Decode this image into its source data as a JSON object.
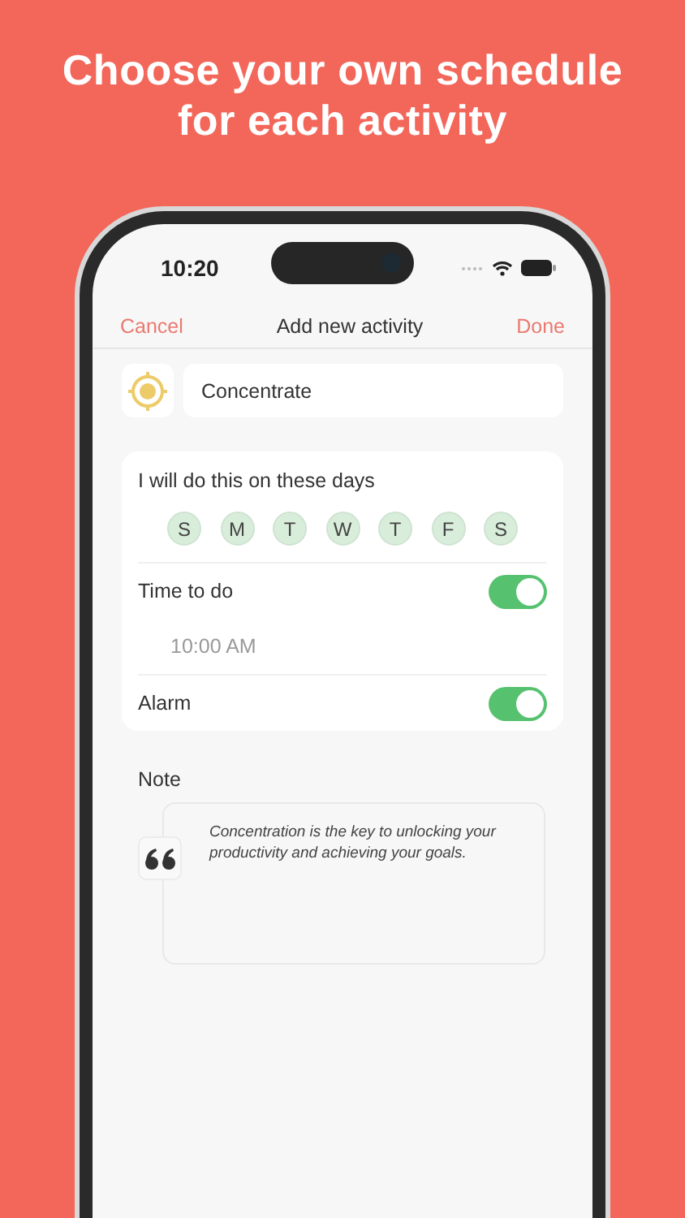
{
  "headline": "Choose your own schedule for each activity",
  "status_bar": {
    "time": "10:20"
  },
  "nav": {
    "cancel": "Cancel",
    "title": "Add new activity",
    "done": "Done"
  },
  "activity": {
    "name": "Concentrate"
  },
  "days": {
    "label": "I will do this on these days",
    "items": [
      {
        "label": "S",
        "selected": true
      },
      {
        "label": "M",
        "selected": true
      },
      {
        "label": "T",
        "selected": true
      },
      {
        "label": "W",
        "selected": true
      },
      {
        "label": "T",
        "selected": true
      },
      {
        "label": "F",
        "selected": true
      },
      {
        "label": "S",
        "selected": true
      }
    ]
  },
  "time_to_do": {
    "label": "Time to do",
    "on": true,
    "time": "10:00 AM"
  },
  "alarm": {
    "label": "Alarm",
    "on": true
  },
  "note": {
    "label": "Note",
    "text": "Concentration is the key to unlocking your productivity and achieving your goals."
  }
}
